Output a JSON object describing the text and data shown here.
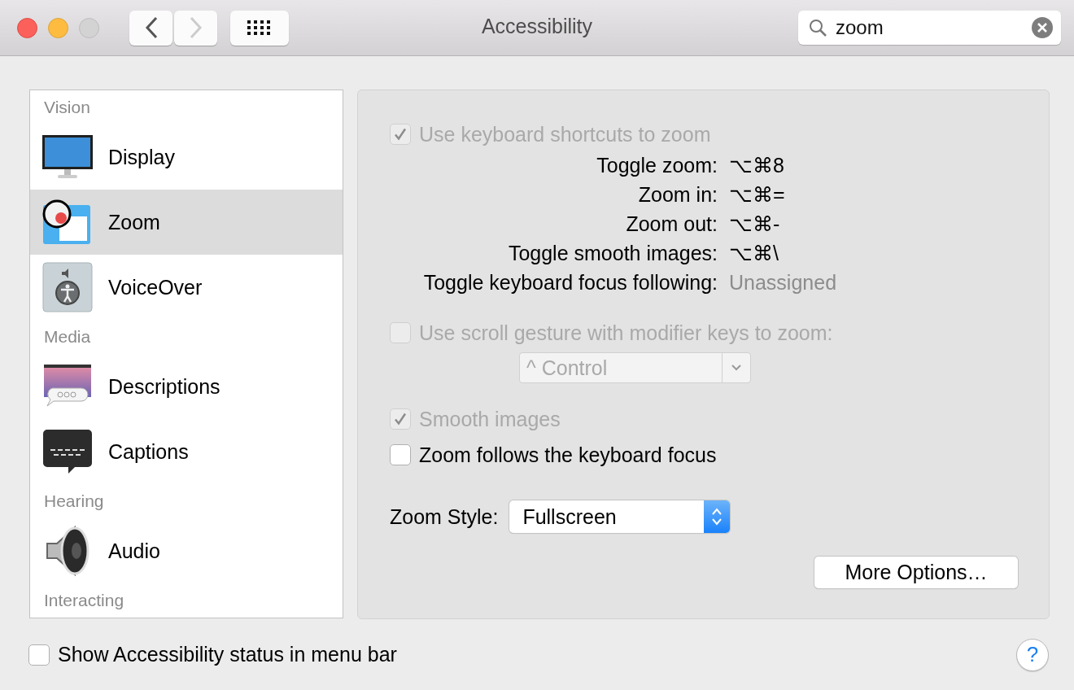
{
  "window": {
    "title": "Accessibility",
    "search": {
      "value": "zoom"
    }
  },
  "sidebar": [
    {
      "kind": "section",
      "label": "Vision"
    },
    {
      "kind": "item",
      "label": "Display",
      "selected": false
    },
    {
      "kind": "item",
      "label": "Zoom",
      "selected": true
    },
    {
      "kind": "item",
      "label": "VoiceOver",
      "selected": false
    },
    {
      "kind": "section",
      "label": "Media"
    },
    {
      "kind": "item",
      "label": "Descriptions",
      "selected": false
    },
    {
      "kind": "item",
      "label": "Captions",
      "selected": false
    },
    {
      "kind": "section",
      "label": "Hearing"
    },
    {
      "kind": "item",
      "label": "Audio",
      "selected": false
    },
    {
      "kind": "section",
      "label": "Interacting"
    }
  ],
  "keyboard_shortcuts": {
    "label": "Use keyboard shortcuts to zoom",
    "checked": true,
    "disabled": true
  },
  "shortcuts": [
    {
      "label": "Toggle zoom:",
      "value": "⌥⌘8",
      "assigned": true
    },
    {
      "label": "Zoom in:",
      "value": "⌥⌘=",
      "assigned": true
    },
    {
      "label": "Zoom out:",
      "value": "⌥⌘-",
      "assigned": true
    },
    {
      "label": "Toggle smooth images:",
      "value": "⌥⌘\\",
      "assigned": true
    },
    {
      "label": "Toggle keyboard focus following:",
      "value": "Unassigned",
      "assigned": false
    }
  ],
  "scroll_gesture": {
    "label": "Use scroll gesture with modifier keys to zoom:",
    "checked": false,
    "disabled": true,
    "modifier": "^ Control"
  },
  "options": [
    {
      "label": "Smooth images",
      "checked": true,
      "disabled": true
    },
    {
      "label": "Zoom follows the keyboard focus",
      "checked": false,
      "disabled": false
    }
  ],
  "zoom_style": {
    "label": "Zoom Style:",
    "value": "Fullscreen"
  },
  "more_options": "More Options…",
  "status_checkbox": {
    "label": "Show Accessibility status in menu bar",
    "checked": false
  },
  "help": "?"
}
